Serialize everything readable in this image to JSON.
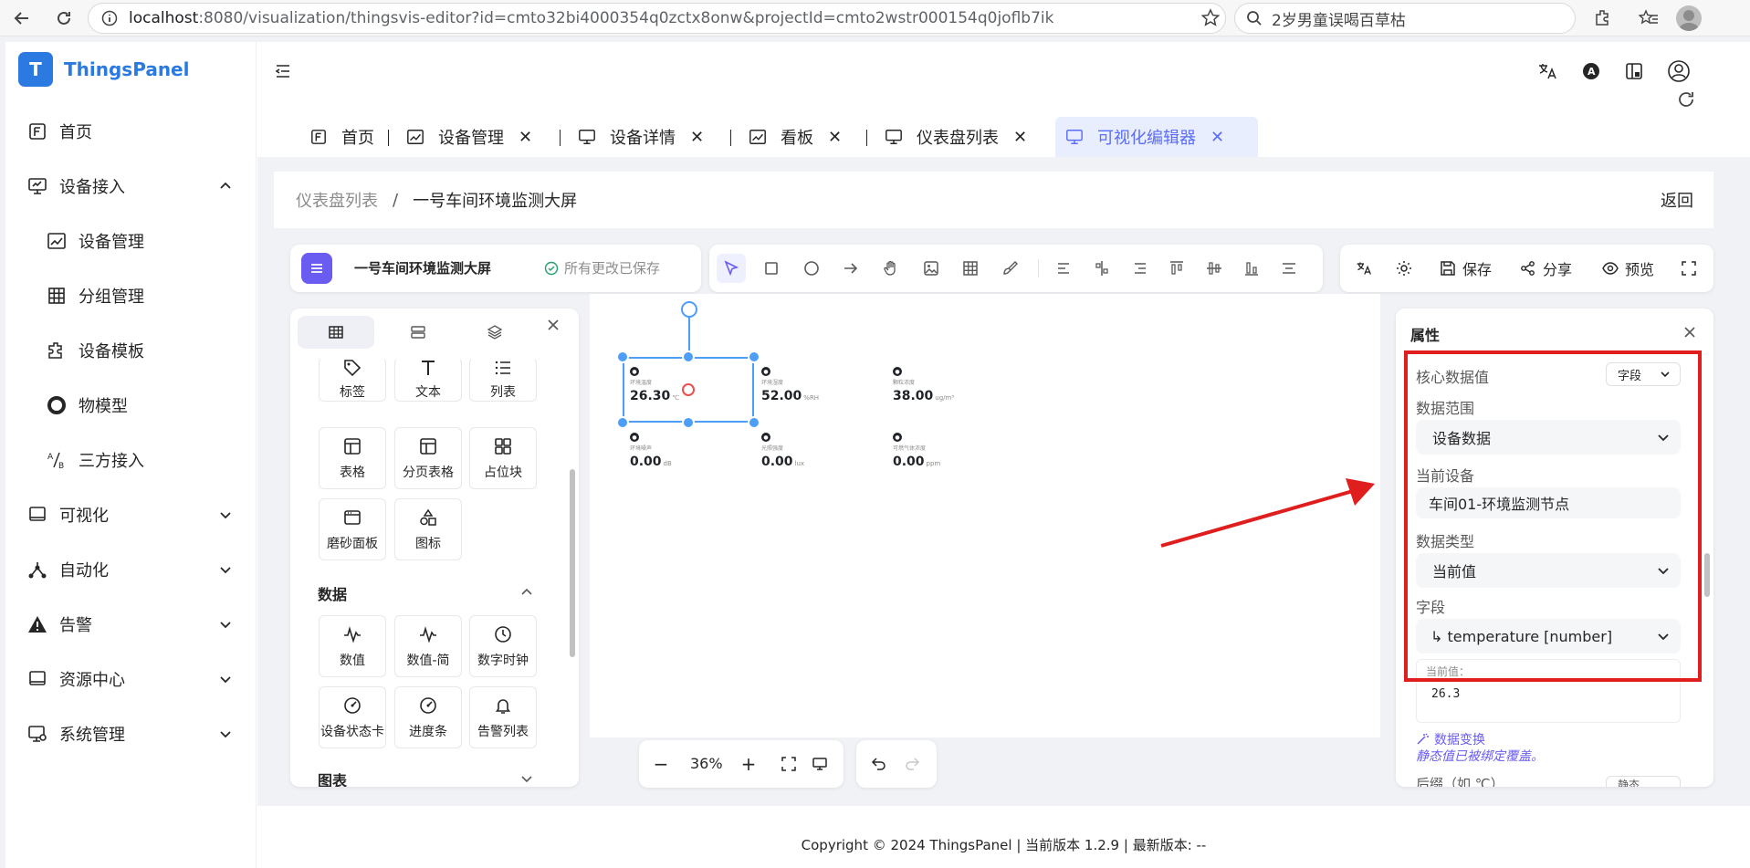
{
  "browser": {
    "url_host": "localhost",
    "url_path": ":8080/visualization/thingsvis-editor?id=cmto32bi4000354q0zctx8onw&projectId=cmto2wstr000154q0joflb7ik",
    "search_text": "2岁男童误喝百草枯"
  },
  "sidebar": {
    "brand": "ThingsPanel",
    "items": [
      {
        "label": "首页"
      },
      {
        "label": "设备接入"
      },
      {
        "label": "设备管理"
      },
      {
        "label": "分组管理"
      },
      {
        "label": "设备模板"
      },
      {
        "label": "物模型"
      },
      {
        "label": "三方接入"
      },
      {
        "label": "可视化"
      },
      {
        "label": "自动化"
      },
      {
        "label": "告警"
      },
      {
        "label": "资源中心"
      },
      {
        "label": "系统管理"
      }
    ]
  },
  "tabs": [
    {
      "label": "首页"
    },
    {
      "label": "设备管理"
    },
    {
      "label": "设备详情"
    },
    {
      "label": "看板"
    },
    {
      "label": "仪表盘列表"
    },
    {
      "label": "可视化编辑器"
    }
  ],
  "breadcrumb": {
    "parent": "仪表盘列表",
    "separator": "/",
    "current": "一号车间环境监测大屏",
    "back": "返回"
  },
  "toolbar": {
    "project_name": "一号车间环境监测大屏",
    "saved_status": "所有更改已保存",
    "save": "保存",
    "share": "分享",
    "preview": "预览"
  },
  "components": {
    "basic": [
      {
        "label": "标签",
        "icon": "tag-icon"
      },
      {
        "label": "文本",
        "icon": "text-icon"
      },
      {
        "label": "列表",
        "icon": "list-icon"
      },
      {
        "label": "表格",
        "icon": "table-icon"
      },
      {
        "label": "分页表格",
        "icon": "paged-table-icon"
      },
      {
        "label": "占位块",
        "icon": "placeholder-icon"
      },
      {
        "label": "磨砂面板",
        "icon": "frosted-panel-icon"
      },
      {
        "label": "图标",
        "icon": "shapes-icon"
      }
    ],
    "data_section": "数据",
    "data": [
      {
        "label": "数值",
        "icon": "pulse-icon"
      },
      {
        "label": "数值-简",
        "icon": "pulse-icon"
      },
      {
        "label": "数字时钟",
        "icon": "clock-icon"
      },
      {
        "label": "设备状态卡",
        "icon": "gauge-icon"
      },
      {
        "label": "进度条",
        "icon": "gauge-icon"
      },
      {
        "label": "告警列表",
        "icon": "bell-icon"
      }
    ],
    "chart_section": "图表"
  },
  "canvas": {
    "metrics": [
      {
        "label": "环境温度",
        "value": "26.30",
        "unit": "℃"
      },
      {
        "label": "环境湿度",
        "value": "52.00",
        "unit": "%RH"
      },
      {
        "label": "颗粒浓度",
        "value": "38.00",
        "unit": "ug/m³"
      },
      {
        "label": "环境噪声",
        "value": "0.00",
        "unit": "dB"
      },
      {
        "label": "光照强度",
        "value": "0.00",
        "unit": "lux"
      },
      {
        "label": "可燃气体浓度",
        "value": "0.00",
        "unit": "ppm"
      }
    ]
  },
  "zoom": {
    "level": "36%"
  },
  "properties": {
    "title": "属性",
    "core_value_label": "核心数据值",
    "core_value_mode": "字段",
    "data_range_label": "数据范围",
    "data_range_value": "设备数据",
    "current_device_label": "当前设备",
    "current_device_value": "车间01-环境监测节点",
    "data_type_label": "数据类型",
    "data_type_value": "当前值",
    "field_label": "字段",
    "field_value": "↳ temperature [number]",
    "current_value_label": "当前值：",
    "current_value": "26.3",
    "transform_label": "数据变换",
    "static_note": "静态值已被绑定覆盖。",
    "next_label": "后缀（如 ℃）",
    "next_mode": "静态"
  },
  "footer": {
    "text": "Copyright © 2024 ThingsPanel  |  当前版本 1.2.9  |  最新版本: --"
  },
  "colors": {
    "brand": "#2a7ae2",
    "accent": "#6a5bf1",
    "selection": "#4d9ef7",
    "annotation": "#e01e1e"
  }
}
